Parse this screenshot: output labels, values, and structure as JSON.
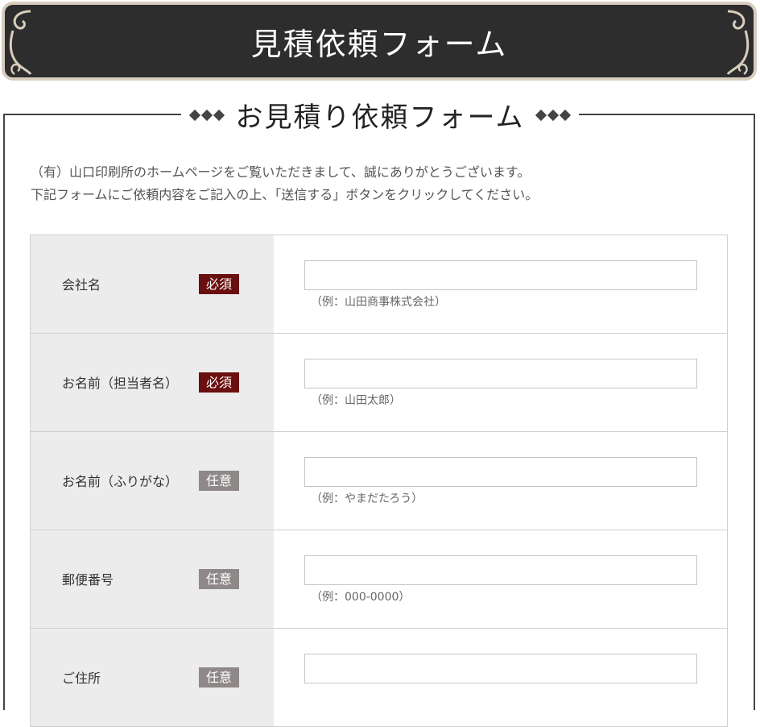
{
  "header": {
    "title": "見積依頼フォーム"
  },
  "section": {
    "title": "お見積り依頼フォーム"
  },
  "intro": {
    "line1": "（有）山口印刷所のホームページをご覧いただきまして、誠にありがとうございます。",
    "line2": "下記フォームにご依頼内容をご記入の上、「送信する」ボタンをクリックしてください。"
  },
  "form": {
    "rows": [
      {
        "label": "会社名",
        "badge": "必須",
        "hint": "（例：山田商事株式会社）",
        "value": ""
      },
      {
        "label": "お名前（担当者名）",
        "badge": "必須",
        "hint": "（例：山田太郎）",
        "value": ""
      },
      {
        "label": "お名前（ふりがな）",
        "badge": "任意",
        "hint": "（例：やまだたろう）",
        "value": ""
      },
      {
        "label": "郵便番号",
        "badge": "任意",
        "hint": "（例：000-0000）",
        "value": ""
      },
      {
        "label": "ご住所",
        "badge": "任意",
        "hint": "",
        "value": ""
      }
    ]
  },
  "colors": {
    "required": "#6a0f0f",
    "optional": "#8f8888",
    "banner": "#2d2d2d"
  }
}
